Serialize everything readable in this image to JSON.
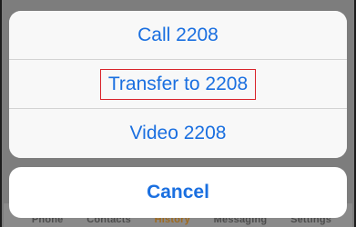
{
  "action_sheet": {
    "actions": [
      {
        "label": "Call 2208"
      },
      {
        "label": "Transfer to 2208"
      },
      {
        "label": "Video 2208"
      }
    ],
    "cancel_label": "Cancel"
  },
  "tab_bar": {
    "tabs": [
      {
        "label": "Phone"
      },
      {
        "label": "Contacts"
      },
      {
        "label": "History"
      },
      {
        "label": "Messaging"
      },
      {
        "label": "Settings"
      }
    ]
  },
  "colors": {
    "action_text": "#1a6fe0",
    "highlight_box": "#d9232a",
    "active_tab": "#a06a1e"
  }
}
